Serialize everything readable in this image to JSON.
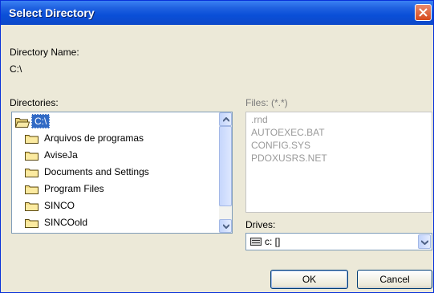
{
  "window": {
    "title": "Select Directory"
  },
  "directory_name": {
    "label": "Directory Name:",
    "value": "C:\\"
  },
  "directories": {
    "label": "Directories:",
    "items": [
      {
        "label": "C:\\",
        "icon": "open-folder-icon",
        "selected": true
      },
      {
        "label": "Arquivos de programas",
        "icon": "folder-icon",
        "selected": false
      },
      {
        "label": "AviseJa",
        "icon": "folder-icon",
        "selected": false
      },
      {
        "label": "Documents and Settings",
        "icon": "folder-icon",
        "selected": false
      },
      {
        "label": "Program Files",
        "icon": "folder-icon",
        "selected": false
      },
      {
        "label": "SINCO",
        "icon": "folder-icon",
        "selected": false
      },
      {
        "label": "SINCOold",
        "icon": "folder-icon",
        "selected": false
      }
    ]
  },
  "files": {
    "label": "Files: (*.*)",
    "items": [
      ".rnd",
      "AUTOEXEC.BAT",
      "CONFIG.SYS",
      "PDOXUSRS.NET"
    ]
  },
  "drives": {
    "label": "Drives:",
    "value": "c: []",
    "icon": "drive-icon"
  },
  "buttons": {
    "ok": "OK",
    "cancel": "Cancel"
  },
  "colors": {
    "title_bar": "#0a4fd8",
    "selection": "#316ac5",
    "dialog_bg": "#ece9d8",
    "close_button": "#d7491c"
  }
}
